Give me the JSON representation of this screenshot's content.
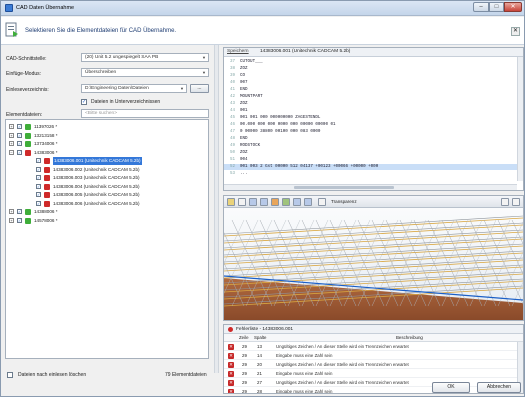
{
  "window": {
    "title": "CAD Daten Übernahme",
    "min": "–",
    "max": "□",
    "close": "✕"
  },
  "banner": {
    "text": "Selektieren Sie die Elementdateien für CAD Übernahme.",
    "close": "✕"
  },
  "form": {
    "interface_label": "CAD-Schnittstelle:",
    "interface_value": "(20) Unit 5.2 ungespiegelt SAA PB",
    "insert_label": "Einfüge-Modus:",
    "insert_value": "Überschreiben",
    "read_dir_label": "Einleseverzeichnis:",
    "read_dir_value": "D:\\Engineering Daten\\Dateien",
    "browse_label": "...",
    "subdir_label": "Dateien in Unterverzeichnissen",
    "subdir_checked": "✓",
    "elements_label": "Elementdateien:",
    "search_placeholder": "<Bitte suchen>"
  },
  "tree": {
    "items": [
      {
        "exp": "+",
        "check": "✓",
        "status": "green",
        "text": "11397026 *",
        "sel": false
      },
      {
        "exp": "+",
        "check": "✓",
        "status": "green",
        "text": "13213158 *",
        "sel": false
      },
      {
        "exp": "+",
        "check": "✓",
        "status": "green",
        "text": "13734006 *",
        "sel": false
      },
      {
        "exp": "−",
        "check": "✓",
        "status": "red",
        "text": "14383006 *",
        "sel": false
      },
      {
        "exp": "",
        "check": "✓",
        "status": "red",
        "text": "14383006.001  (Unitechnik CADCAM 5.2b)",
        "sel": true
      },
      {
        "exp": "",
        "check": "✓",
        "status": "red",
        "text": "14383006.002  (Unitechnik CADCAM 5.2b)",
        "sel": false
      },
      {
        "exp": "",
        "check": "✓",
        "status": "red",
        "text": "14383006.003  (Unitechnik CADCAM 5.2b)",
        "sel": false
      },
      {
        "exp": "",
        "check": "✓",
        "status": "red",
        "text": "14383006.004  (Unitechnik CADCAM 5.2b)",
        "sel": false
      },
      {
        "exp": "",
        "check": "✓",
        "status": "red",
        "text": "14383006.005  (Unitechnik CADCAM 5.2b)",
        "sel": false
      },
      {
        "exp": "",
        "check": "✓",
        "status": "red",
        "text": "14383006.006  (Unitechnik CADCAM 5.2b)",
        "sel": false
      },
      {
        "exp": "+",
        "check": "✓",
        "status": "green",
        "text": "14388006 *",
        "sel": false
      },
      {
        "exp": "+",
        "check": "✓",
        "status": "green",
        "text": "14578006 *",
        "sel": false
      }
    ]
  },
  "footer": {
    "delete_after_label": "Dateien nach einlesen löschen",
    "count_label": "79 Elementdateien",
    "ok": "OK",
    "cancel": "Abbrechen"
  },
  "code": {
    "tab_link": "Speichern",
    "tab_file": "14383006.001  (Unitechnik CADCAM 5.2b)",
    "lines": [
      {
        "n": "37",
        "t": "CUTOUT___"
      },
      {
        "n": "38",
        "t": "ZOZ"
      },
      {
        "n": "39",
        "t": "CO"
      },
      {
        "n": "40",
        "t": "007"
      },
      {
        "n": "41",
        "t": "END"
      },
      {
        "n": "42",
        "t": "MOUNTPART"
      },
      {
        "n": "43",
        "t": "ZOZ"
      },
      {
        "n": "44",
        "t": "001"
      },
      {
        "n": "45",
        "t": "001 001 000 000000000 ZAGESTENDL"
      },
      {
        "n": "46",
        "t": "00.000 000 000 0000 000 00000 00000 01"
      },
      {
        "n": "47",
        "t": "0 00000 38800 00100 000 083 0000"
      },
      {
        "n": "48",
        "t": "END"
      },
      {
        "n": "49",
        "t": "RODSTOCK"
      },
      {
        "n": "50",
        "t": "ZOZ"
      },
      {
        "n": "51",
        "t": "004"
      },
      {
        "n": "52",
        "t": "001 003 2 Gst 00000 512 04137 +00123 +00066 +00000 +000"
      },
      {
        "n": "53",
        "t": "..."
      }
    ]
  },
  "viewer": {
    "transparency_label": "Transparenz"
  },
  "errors": {
    "header": "Fehlerliste  -  14383006.001",
    "col_line": "Zeile",
    "col_col": "Spalte",
    "col_desc": "Beschreibung",
    "rows": [
      {
        "z": "29",
        "s": "13",
        "m": "Ungültiges Zeichen / An dieser Stelle wird ein Trennzeichen erwartet"
      },
      {
        "z": "29",
        "s": "14",
        "m": "Eingabe muss eine Zahl sein"
      },
      {
        "z": "29",
        "s": "20",
        "m": "Ungültiges Zeichen / An dieser Stelle wird ein Trennzeichen erwartet"
      },
      {
        "z": "29",
        "s": "21",
        "m": "Eingabe muss eine Zahl sein"
      },
      {
        "z": "29",
        "s": "27",
        "m": "Ungültiges Zeichen / An dieser Stelle wird ein Trennzeichen erwartet"
      },
      {
        "z": "29",
        "s": "28",
        "m": "Eingabe muss eine Zahl sein"
      },
      {
        "z": "29",
        "s": "34",
        "m": "Ungültiges Zeichen / An dieser Stelle wird ein Trennzeichen erwartet"
      }
    ]
  },
  "colors": {
    "accent": "#3478d9",
    "ok_status": "#3fae3a",
    "error_status": "#cf2a2a"
  }
}
